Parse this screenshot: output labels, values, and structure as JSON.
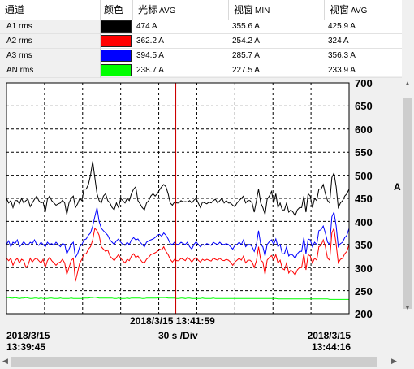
{
  "table": {
    "headers": {
      "channel": "通道",
      "color": "颜色",
      "cursor_avg_label": "光标",
      "cursor_avg_unit": "AVG",
      "window_min_label": "视窗",
      "window_min_unit": "MIN",
      "window_avg_label": "视窗",
      "window_avg_unit": "AVG"
    },
    "rows": [
      {
        "name": "A1 rms",
        "color": "#000000",
        "cursor_avg": "474 A",
        "window_min": "355.6 A",
        "window_avg": "425.9 A"
      },
      {
        "name": "A2 rms",
        "color": "#ff0000",
        "cursor_avg": "362.2 A",
        "window_min": "254.2 A",
        "window_avg": "324 A"
      },
      {
        "name": "A3 rms",
        "color": "#0000ff",
        "cursor_avg": "394.5 A",
        "window_min": "285.7 A",
        "window_avg": "356.3 A"
      },
      {
        "name": "AN rms",
        "color": "#00ff00",
        "cursor_avg": "238.7 A",
        "window_min": "227.5 A",
        "window_avg": "233.9 A"
      }
    ]
  },
  "chart_data": {
    "type": "line",
    "ylabel": "A",
    "ylim": [
      200,
      700
    ],
    "yticks": [
      "700",
      "650",
      "600",
      "550",
      "500",
      "450",
      "400",
      "350",
      "300",
      "250",
      "200"
    ],
    "x_start": "2018/3/15 13:39:45",
    "x_end": "2018/3/15 13:44:16",
    "x_division": "30 s /Div",
    "cursor_time": "2018/3/15 13:41:59",
    "cursor_position_fraction": 0.494,
    "grid": true,
    "series": [
      {
        "key": "A1",
        "color": "#000000",
        "values": [
          450,
          440,
          445,
          430,
          445,
          445,
          438,
          450,
          440,
          445,
          448,
          432,
          440,
          448,
          455,
          445,
          440,
          442,
          420,
          448,
          455,
          445,
          440,
          435,
          438,
          440,
          446,
          440,
          415,
          440,
          450,
          455,
          430,
          438,
          450,
          445,
          470,
          470,
          480,
          500,
          530,
          495,
          460,
          445,
          440,
          455,
          460,
          445,
          440,
          430,
          425,
          440,
          430,
          450,
          445,
          440,
          450,
          445,
          460,
          470,
          475,
          445,
          438,
          430,
          425,
          440,
          445,
          455,
          460,
          455,
          460,
          468,
          475,
          480,
          475,
          460,
          440,
          435,
          442,
          440,
          440,
          445,
          442,
          443,
          442,
          445,
          440,
          446,
          450,
          440,
          430,
          442,
          440,
          438,
          442,
          440,
          445,
          448,
          440,
          445,
          450,
          440,
          445,
          440,
          440,
          435,
          432,
          440,
          445,
          450,
          455,
          440,
          445,
          445,
          440,
          420,
          445,
          470,
          440,
          430,
          415,
          448,
          455,
          465,
          440,
          460,
          430,
          440,
          425,
          425,
          440,
          420,
          425,
          420,
          412,
          425,
          430,
          430,
          455,
          420,
          460,
          455,
          430,
          450,
          445,
          470,
          470,
          480,
          460,
          445,
          440,
          495,
          505,
          475,
          430,
          440,
          445,
          455,
          460,
          470
        ]
      },
      {
        "key": "A3",
        "color": "#0000ff",
        "values": [
          350,
          358,
          345,
          355,
          352,
          360,
          345,
          350,
          356,
          350,
          348,
          355,
          352,
          360,
          350,
          348,
          355,
          350,
          345,
          355,
          350,
          352,
          348,
          355,
          350,
          345,
          352,
          350,
          330,
          340,
          350,
          355,
          322,
          330,
          345,
          350,
          360,
          362,
          370,
          375,
          390,
          410,
          430,
          400,
          385,
          380,
          375,
          370,
          360,
          355,
          350,
          358,
          362,
          355,
          350,
          348,
          355,
          350,
          360,
          365,
          360,
          362,
          355,
          350,
          345,
          355,
          358,
          360,
          362,
          365,
          370,
          372,
          368,
          375,
          370,
          362,
          352,
          350,
          355,
          350,
          350,
          355,
          352,
          350,
          355,
          345,
          340,
          350,
          356,
          350,
          345,
          350,
          348,
          352,
          350,
          348,
          355,
          352,
          350,
          355,
          350,
          350,
          352,
          350,
          345,
          340,
          348,
          350,
          355,
          350,
          360,
          345,
          350,
          350,
          345,
          335,
          350,
          380,
          350,
          345,
          325,
          350,
          356,
          360,
          350,
          362,
          345,
          350,
          330,
          330,
          345,
          325,
          330,
          326,
          320,
          330,
          335,
          335,
          365,
          330,
          362,
          360,
          345,
          355,
          350,
          380,
          382,
          390,
          375,
          355,
          350,
          410,
          420,
          390,
          345,
          352,
          355,
          365,
          370,
          385
        ]
      },
      {
        "key": "A2",
        "color": "#ff0000",
        "values": [
          320,
          315,
          320,
          305,
          315,
          320,
          310,
          318,
          315,
          300,
          305,
          320,
          312,
          318,
          320,
          315,
          310,
          318,
          300,
          315,
          322,
          315,
          310,
          305,
          310,
          312,
          318,
          310,
          285,
          300,
          315,
          320,
          270,
          290,
          310,
          318,
          330,
          330,
          340,
          345,
          360,
          385,
          380,
          370,
          345,
          340,
          335,
          338,
          325,
          320,
          315,
          322,
          328,
          320,
          315,
          310,
          318,
          315,
          325,
          330,
          322,
          325,
          318,
          312,
          310,
          318,
          322,
          328,
          330,
          332,
          335,
          340,
          338,
          345,
          335,
          328,
          318,
          312,
          318,
          315,
          315,
          320,
          318,
          315,
          322,
          318,
          312,
          318,
          322,
          316,
          312,
          318,
          315,
          318,
          316,
          314,
          320,
          318,
          316,
          320,
          316,
          315,
          318,
          316,
          312,
          305,
          312,
          316,
          320,
          316,
          325,
          310,
          316,
          316,
          312,
          300,
          315,
          345,
          316,
          312,
          285,
          316,
          322,
          326,
          316,
          328,
          310,
          316,
          298,
          295,
          310,
          288,
          295,
          290,
          284,
          295,
          300,
          300,
          330,
          295,
          328,
          325,
          310,
          320,
          316,
          345,
          348,
          360,
          345,
          320,
          316,
          375,
          385,
          350,
          310,
          318,
          320,
          330,
          335,
          350
        ]
      },
      {
        "key": "AN",
        "color": "#00ff00",
        "values": [
          235,
          235,
          234,
          234,
          235,
          234,
          233,
          234,
          234,
          235,
          234,
          233,
          233,
          234,
          234,
          233,
          234,
          233,
          233,
          233,
          234,
          234,
          233,
          233,
          233,
          234,
          233,
          233,
          233,
          233,
          234,
          233,
          233,
          233,
          233,
          233,
          234,
          234,
          234,
          235,
          235,
          236,
          235,
          234,
          234,
          234,
          234,
          234,
          234,
          234,
          233,
          233,
          234,
          233,
          233,
          233,
          234,
          233,
          234,
          234,
          234,
          234,
          234,
          233,
          233,
          234,
          234,
          234,
          234,
          234,
          234,
          235,
          235,
          235,
          235,
          234,
          234,
          234,
          234,
          233,
          233,
          234,
          234,
          233,
          234,
          234,
          233,
          233,
          233,
          233,
          233,
          234,
          233,
          233,
          233,
          233,
          234,
          233,
          233,
          233,
          233,
          233,
          233,
          233,
          233,
          233,
          233,
          233,
          233,
          233,
          233,
          233,
          233,
          233,
          233,
          233,
          233,
          233,
          233,
          233,
          233,
          233,
          233,
          233,
          233,
          233,
          232,
          232,
          232,
          232,
          232,
          232,
          232,
          232,
          232,
          232,
          232,
          232,
          232,
          232,
          232,
          232,
          232,
          232,
          232,
          232,
          232,
          232,
          232,
          232,
          231,
          231,
          231,
          231,
          231,
          231,
          231,
          231,
          231,
          231
        ]
      }
    ]
  },
  "scrollbars": {
    "up_arrow_icon": "triangle-up",
    "down_arrow_icon": "triangle-down",
    "left_arrow_icon": "triangle-left",
    "right_arrow_icon": "triangle-right"
  }
}
